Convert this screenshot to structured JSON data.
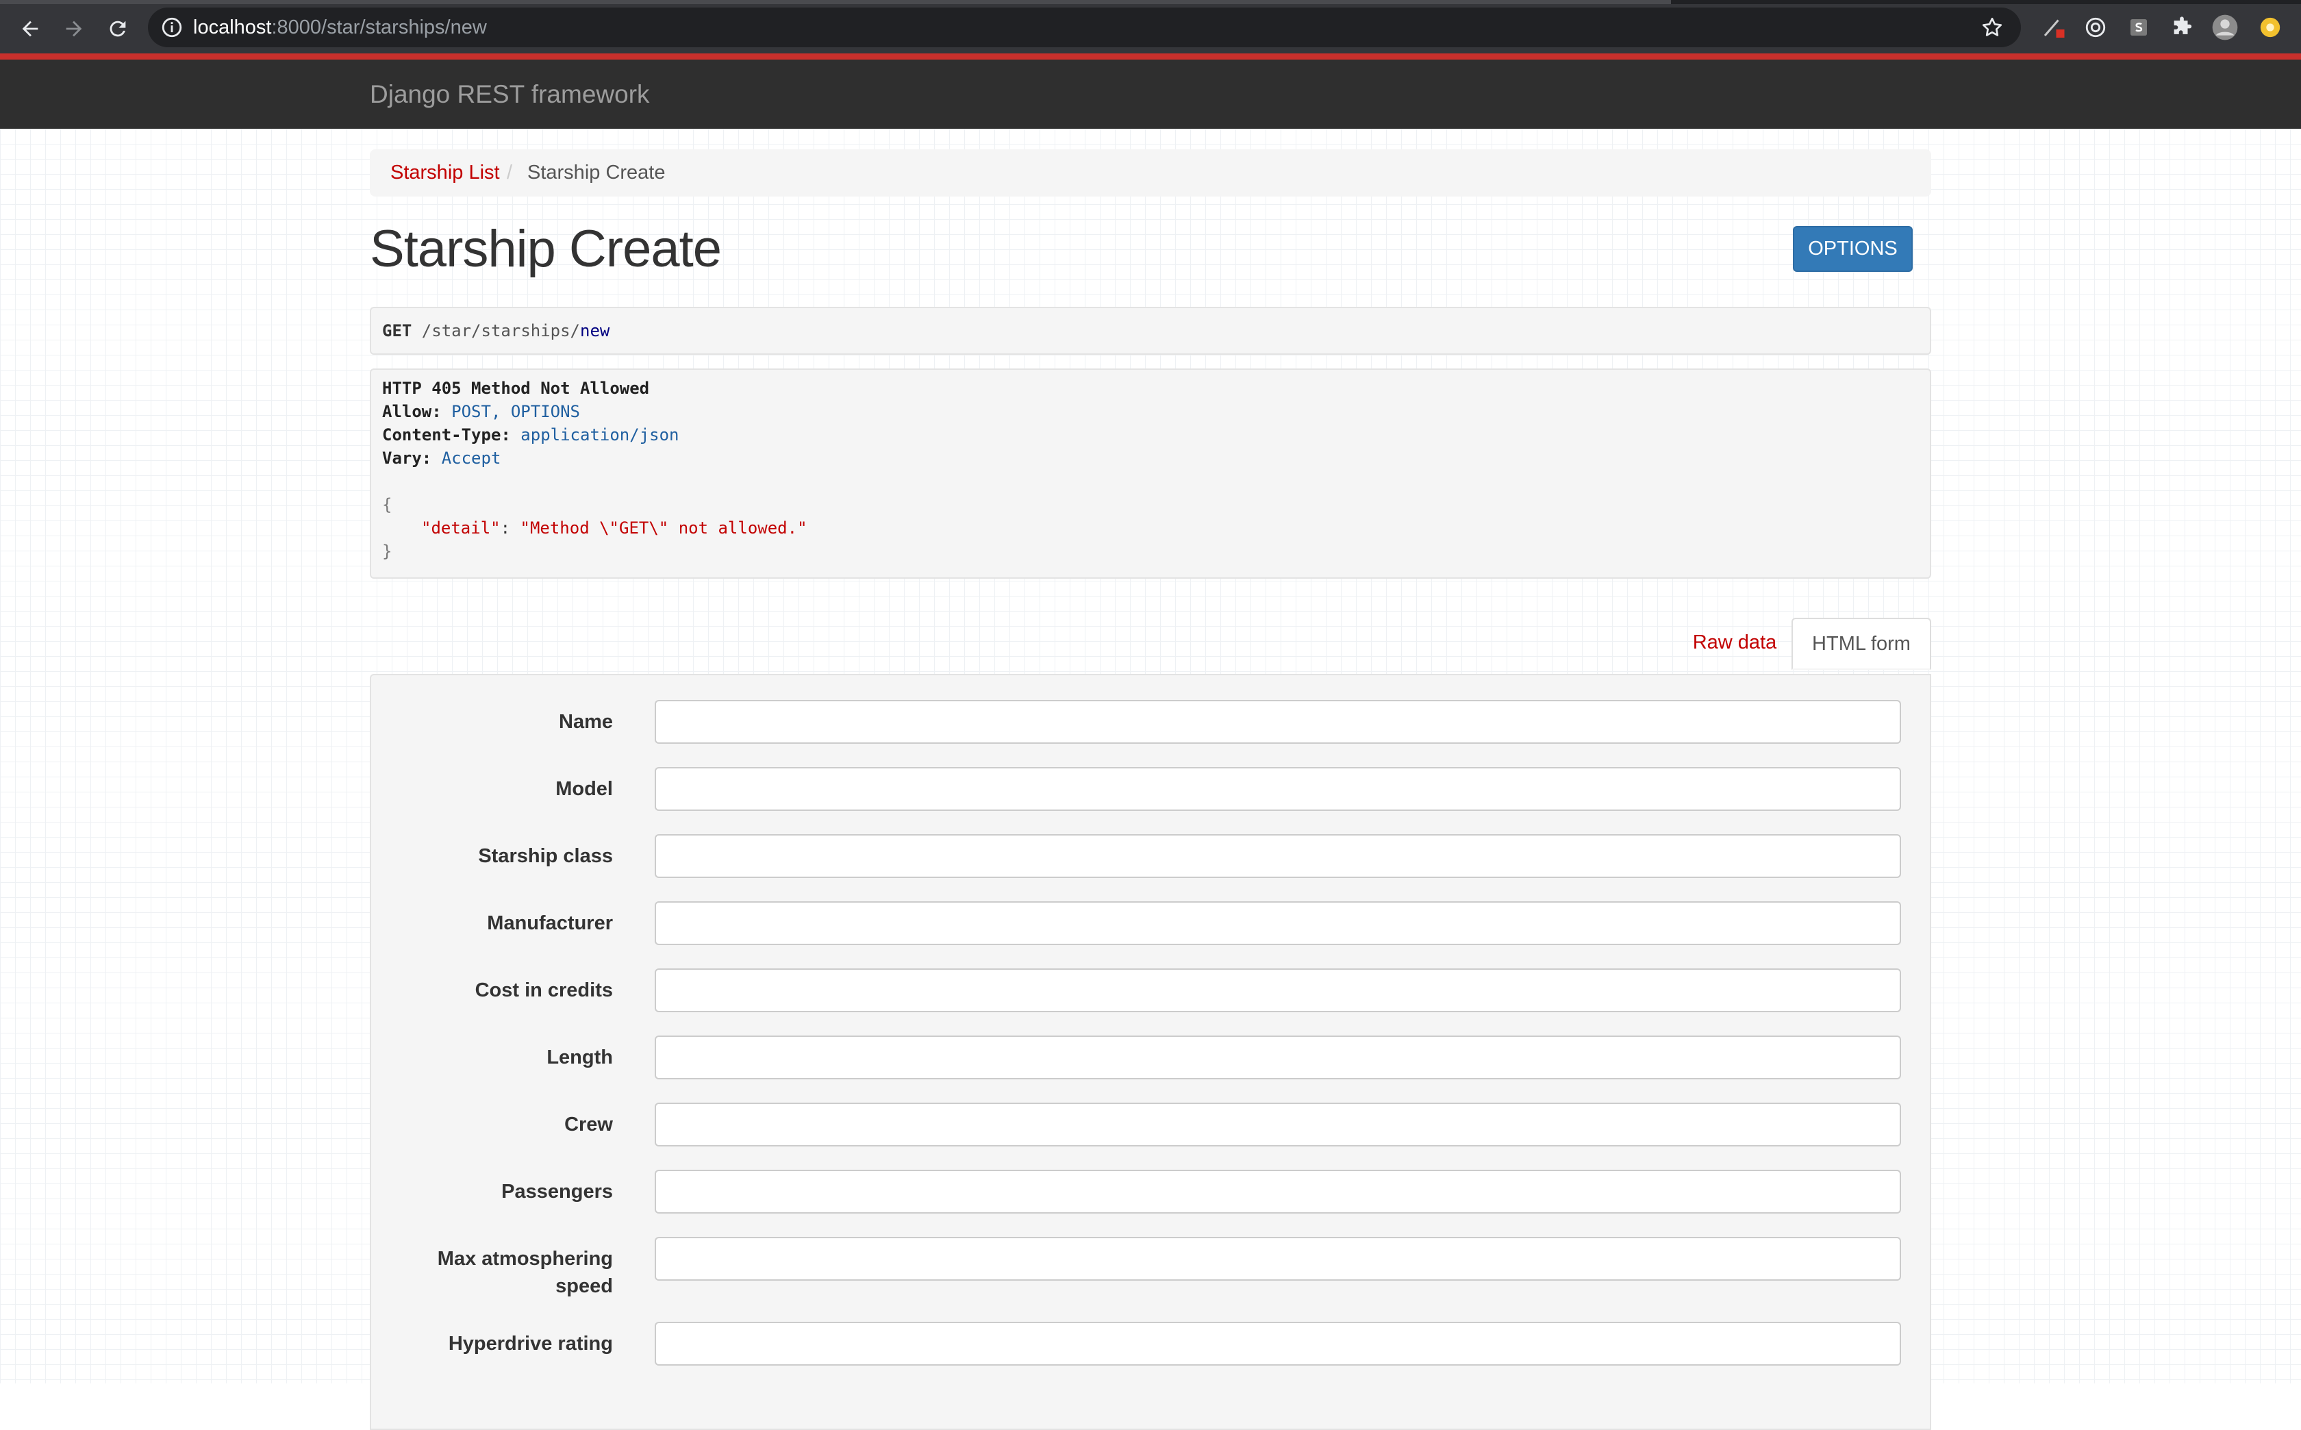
{
  "browser": {
    "url_host": "localhost",
    "url_path": ":8000/star/starships/new",
    "icons": [
      "back-arrow-icon",
      "forward-arrow-icon",
      "reload-icon",
      "info-icon",
      "star-icon",
      "extension-icons"
    ]
  },
  "navbar": {
    "brand": "Django REST framework"
  },
  "breadcrumb": {
    "link": "Starship List",
    "separator": "/",
    "active": "Starship Create"
  },
  "page": {
    "title": "Starship Create",
    "options_label": "OPTIONS"
  },
  "request": {
    "method": "GET",
    "path_prefix": " /star/",
    "path_mid": "starships/",
    "path_end": "new"
  },
  "response": {
    "status": "HTTP 405 Method Not Allowed",
    "headers": [
      {
        "name": "Allow:",
        "value": "POST, OPTIONS"
      },
      {
        "name": "Content-Type:",
        "value": "application/json"
      },
      {
        "name": "Vary:",
        "value": "Accept"
      }
    ],
    "open_brace": "{",
    "key": "\"detail\"",
    "colon": ": ",
    "value": "\"Method \\\"GET\\\" not allowed.\"",
    "close_brace": "}"
  },
  "tabs": {
    "raw": "Raw data",
    "form": "HTML form"
  },
  "form": {
    "fields": [
      {
        "label": "Name",
        "value": ""
      },
      {
        "label": "Model",
        "value": ""
      },
      {
        "label": "Starship class",
        "value": ""
      },
      {
        "label": "Manufacturer",
        "value": ""
      },
      {
        "label": "Cost in credits",
        "value": ""
      },
      {
        "label": "Length",
        "value": ""
      },
      {
        "label": "Crew",
        "value": ""
      },
      {
        "label": "Passengers",
        "value": ""
      },
      {
        "label": "Max atmosphering speed",
        "value": ""
      },
      {
        "label": "Hyperdrive rating",
        "value": ""
      }
    ]
  },
  "colors": {
    "accent": "#c20000",
    "button": "#337ab7",
    "navbar": "#2f2f2f"
  }
}
